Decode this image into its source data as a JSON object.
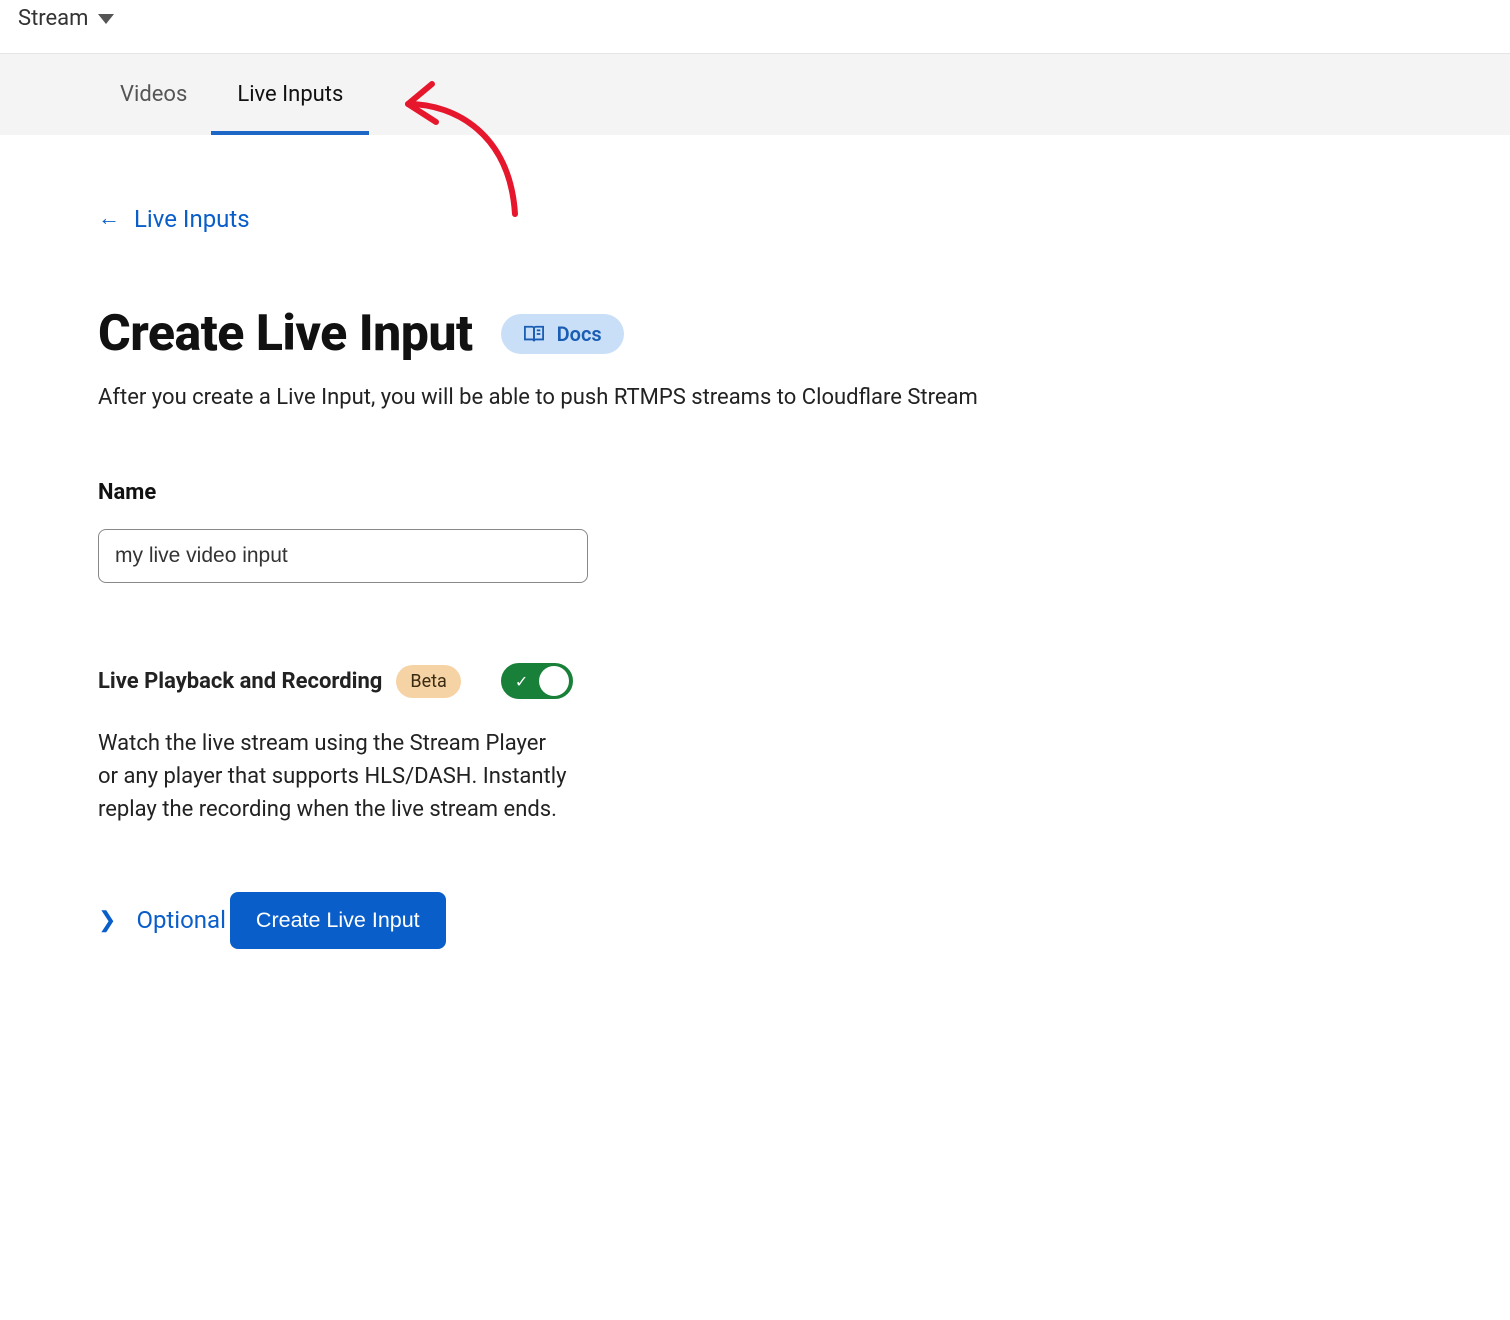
{
  "header": {
    "dropdown_label": "Stream"
  },
  "tabs": {
    "videos": "Videos",
    "live_inputs": "Live Inputs"
  },
  "back_link": {
    "label": "Live Inputs"
  },
  "page": {
    "title": "Create Live Input",
    "docs_label": "Docs",
    "subtitle": "After you create a Live Input, you will be able to push RTMPS streams to Cloudflare Stream"
  },
  "form": {
    "name_label": "Name",
    "name_value": "my live video input",
    "playback_label": "Live Playback and Recording",
    "beta_badge": "Beta",
    "playback_toggle_on": true,
    "playback_description": "Watch the live stream using the Stream Player or any player that supports HLS/DASH. Instantly replay the recording when the live stream ends.",
    "optional_label": "Optional",
    "submit_label": "Create Live Input"
  },
  "colors": {
    "accent": "#0a5ec9",
    "toggle_on": "#198039",
    "beta_bg": "#f6d3a5",
    "docs_bg": "#c9dff8",
    "annotation_arrow": "#e6172c"
  }
}
